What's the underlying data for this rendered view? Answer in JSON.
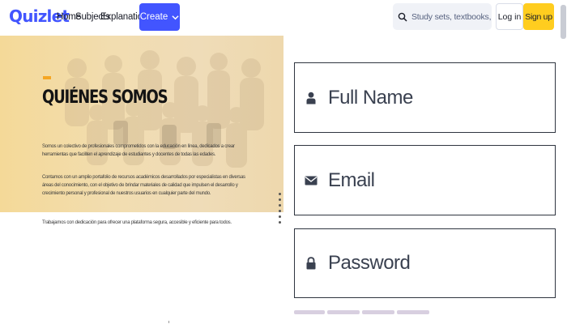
{
  "header": {
    "logo": "Quizlet",
    "nav": [
      "Home",
      "Subjects",
      "Explanations"
    ],
    "create_label": "Create",
    "search_placeholder": "Study sets, textbooks, ...",
    "login_label": "Log in",
    "signup_label": "Sign up"
  },
  "hero": {
    "title": "QUIÉNES SOMOS",
    "paragraphs": [
      "Somos un colectivo de profesionales comprometidos con la educación en línea, dedicados a crear herramientas que faciliten el aprendizaje de estudiantes y docentes de todas las edades.",
      "Contamos con un amplio portafolio de recursos académicos desarrollados por especialistas en diversas áreas del conocimiento, con el objetivo de brindar materiales de calidad que impulsen el desarrollo y crecimiento personal y profesional de nuestros usuarios en cualquier parte del mundo.",
      "Trabajamos con dedicación para ofrecer una plataforma segura, accesible y eficiente para todos."
    ]
  },
  "form": {
    "full_name_placeholder": "Full Name",
    "email_placeholder": "Email",
    "password_placeholder": "Password"
  },
  "colors": {
    "brand": "#4255ff",
    "signup": "#ffcd1f",
    "accent": "#f5a623"
  },
  "icons": {
    "search": "search-icon",
    "user": "user-icon",
    "email": "envelope-icon",
    "password": "lock-icon",
    "create": "chevron-down-icon"
  }
}
